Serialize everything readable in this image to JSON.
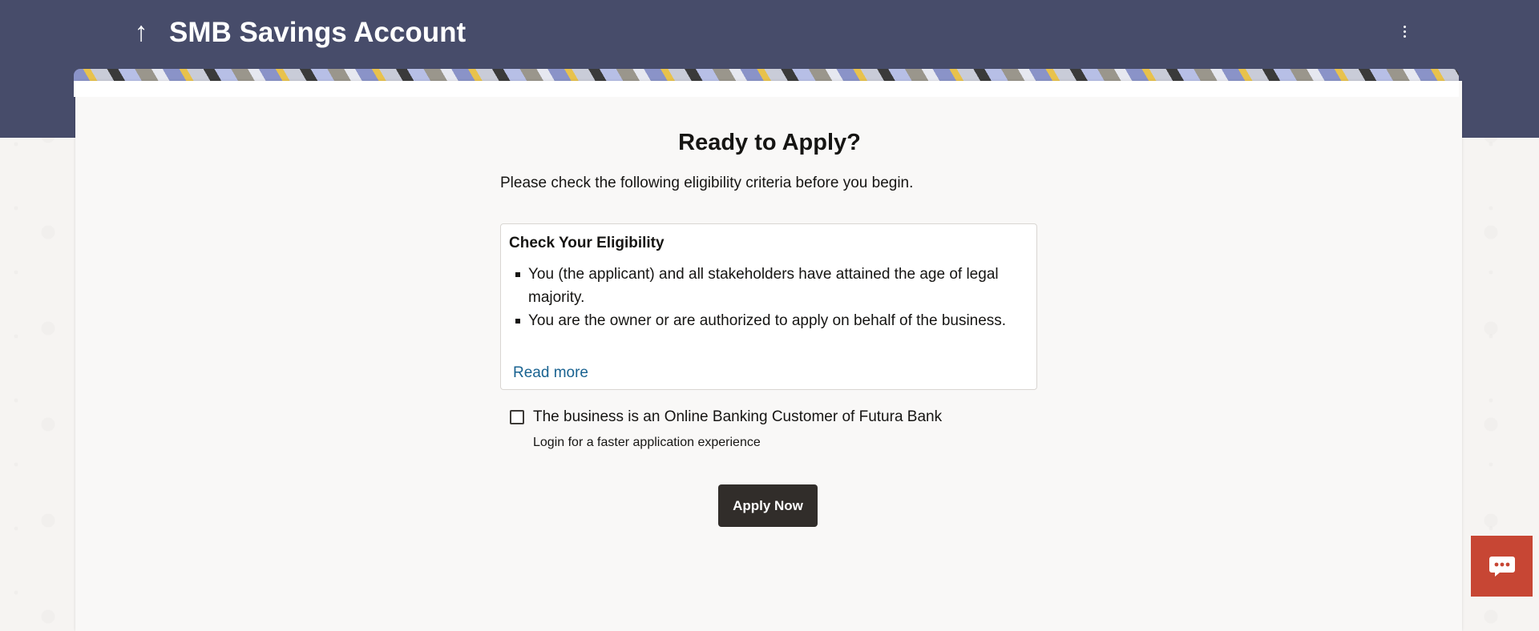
{
  "header": {
    "back_icon": "arrow-up-icon",
    "title": "SMB Savings Account",
    "menu_icon": "kebab-menu-icon",
    "background": "#474c6a"
  },
  "main": {
    "heading": "Ready to Apply?",
    "subtitle": "Please check the following eligibility criteria before you begin.",
    "eligibility": {
      "title": "Check Your Eligibility",
      "items": [
        "You (the applicant) and all stakeholders have attained the age of legal majority.",
        "You are the owner or are authorized to apply on behalf of the business."
      ],
      "read_more": "Read more"
    },
    "customer_checkbox": {
      "label": "The business is an Online Banking Customer of Futura Bank",
      "checked": false,
      "helper": "Login for a faster application experience"
    },
    "apply_button": "Apply Now"
  },
  "chat": {
    "icon": "chat-bubble-icon",
    "color": "#c74634"
  },
  "colors": {
    "link": "#1a6391",
    "primary_button": "#312d2a"
  }
}
